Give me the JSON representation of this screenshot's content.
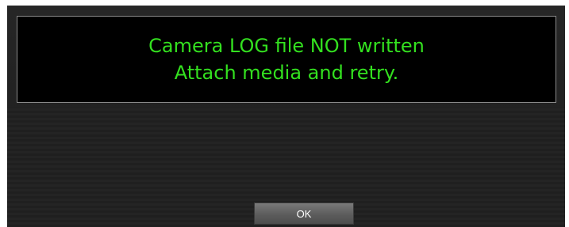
{
  "dialog": {
    "message_lines": [
      "Camera LOG file NOT written",
      "Attach media and retry."
    ],
    "ok_label": "OK"
  },
  "colors": {
    "message_text": "#33e01f",
    "panel_background": "#000000",
    "dialog_background": "#222222",
    "button_background": "#6a6a6a"
  }
}
